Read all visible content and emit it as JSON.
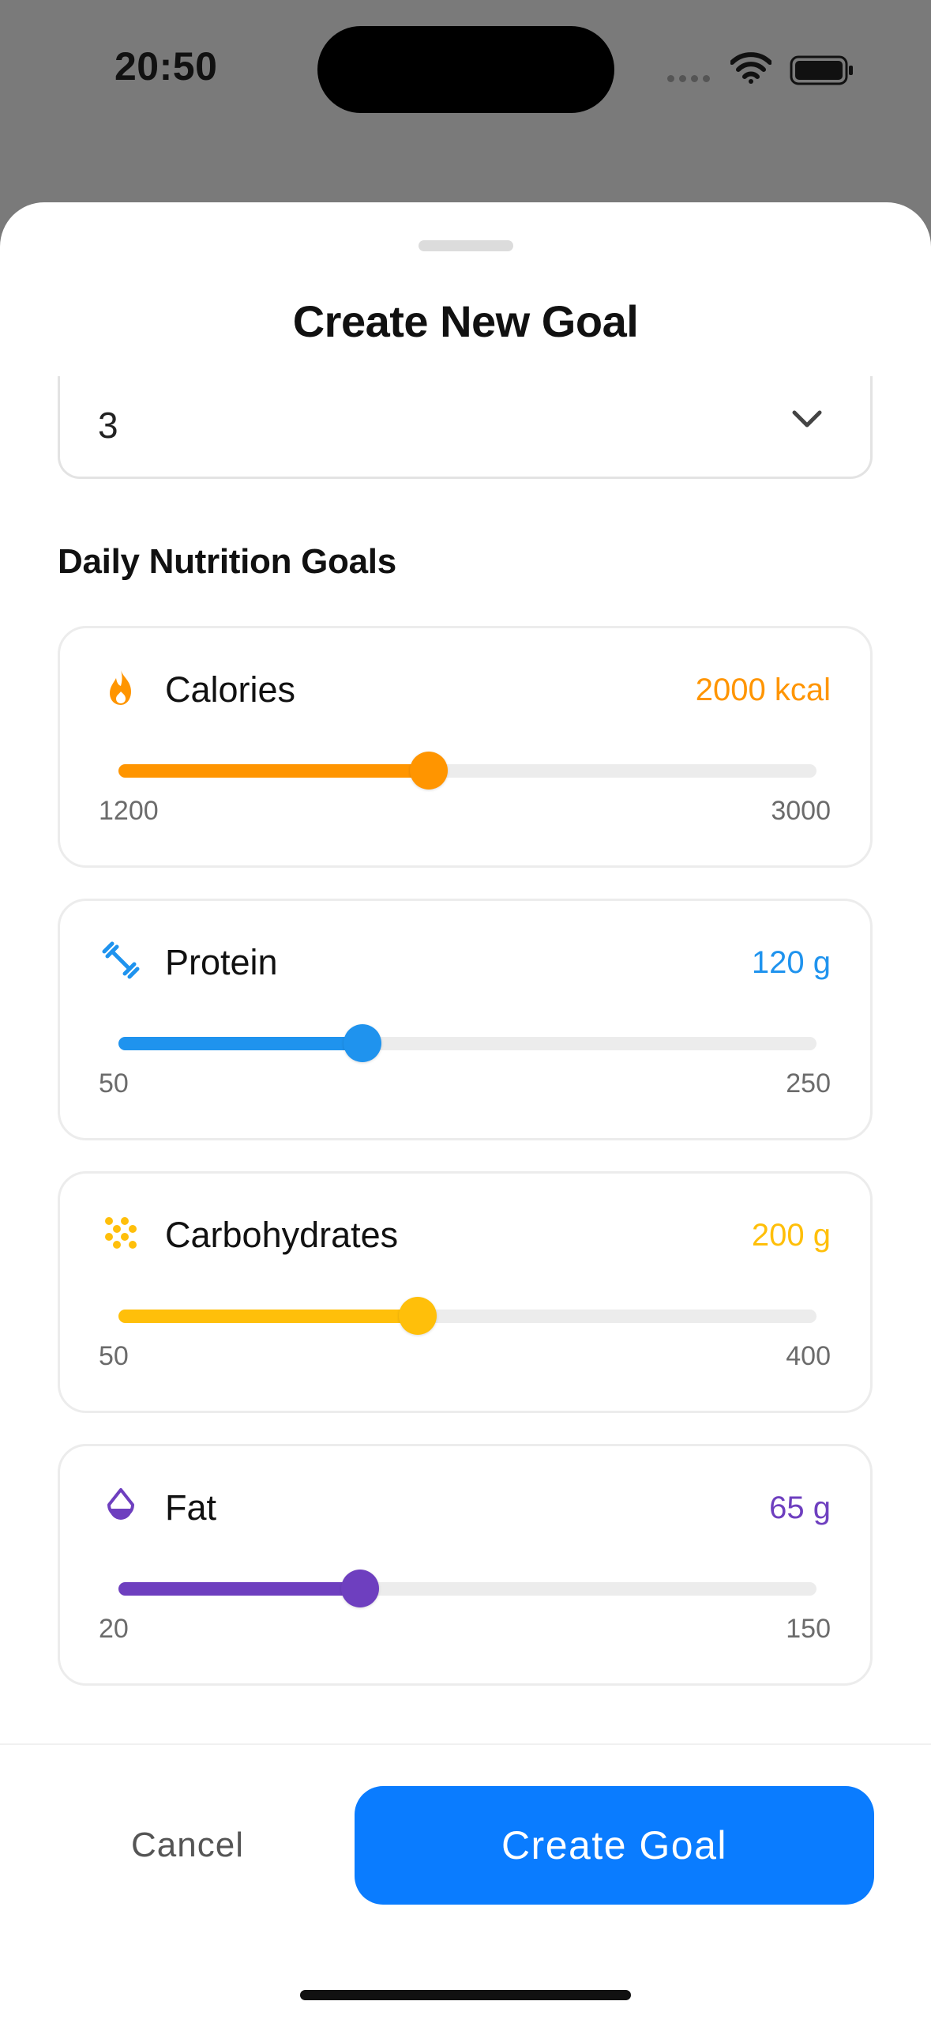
{
  "status_bar": {
    "time": "20:50"
  },
  "sheet": {
    "title": "Create New Goal",
    "select": {
      "value": "3",
      "icon": "chevron-down-icon"
    }
  },
  "nutrition": {
    "heading": "Daily Nutrition Goals",
    "items": [
      {
        "label": "Calories",
        "value_text": "2000 kcal",
        "value": 2000,
        "min": 1200,
        "max": 3000,
        "min_label": "1200",
        "max_label": "3000",
        "color": "#ff9500",
        "icon": "flame-icon"
      },
      {
        "label": "Protein",
        "value_text": "120 g",
        "value": 120,
        "min": 50,
        "max": 250,
        "min_label": "50",
        "max_label": "250",
        "color": "#1f93ee",
        "icon": "dumbbell-icon"
      },
      {
        "label": "Carbohydrates",
        "value_text": "200 g",
        "value": 200,
        "min": 50,
        "max": 400,
        "min_label": "50",
        "max_label": "400",
        "color": "#ffbf0a",
        "icon": "grains-icon"
      },
      {
        "label": "Fat",
        "value_text": "65 g",
        "value": 65,
        "min": 20,
        "max": 150,
        "min_label": "20",
        "max_label": "150",
        "color": "#6e3fbf",
        "icon": "drop-icon"
      }
    ]
  },
  "footer": {
    "cancel_label": "Cancel",
    "create_label": "Create Goal",
    "accent": "#0a7cff"
  }
}
